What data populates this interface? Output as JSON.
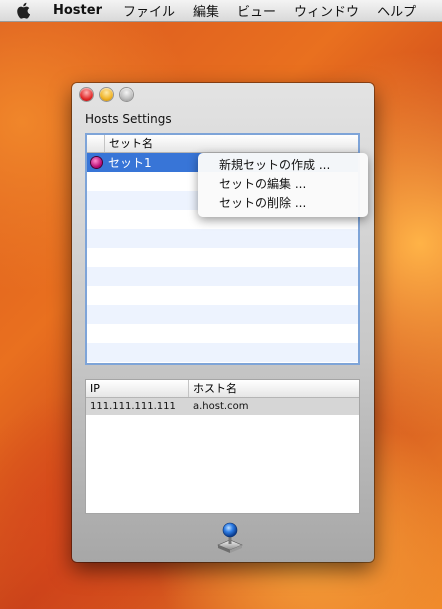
{
  "menubar": {
    "apple_icon": "apple-logo-icon",
    "app_name": "Hoster",
    "items": [
      "ファイル",
      "編集",
      "ビュー",
      "ウィンドウ",
      "ヘルプ"
    ]
  },
  "window": {
    "title": "Hosts Settings",
    "traffic_lights": [
      "close",
      "minimize",
      "zoom"
    ]
  },
  "set_table": {
    "header": "セット名",
    "rows": [
      {
        "label": "セット1",
        "selected": true
      }
    ]
  },
  "context_menu": {
    "items": [
      "新規セットの作成 ...",
      "セットの編集 ...",
      "セットの削除 ..."
    ]
  },
  "hosts_table": {
    "columns": [
      "IP",
      "ホスト名"
    ],
    "rows": [
      {
        "ip": "111.111.111.111",
        "host": "a.host.com"
      }
    ]
  },
  "bottom": {
    "icon": "joystick-icon"
  }
}
